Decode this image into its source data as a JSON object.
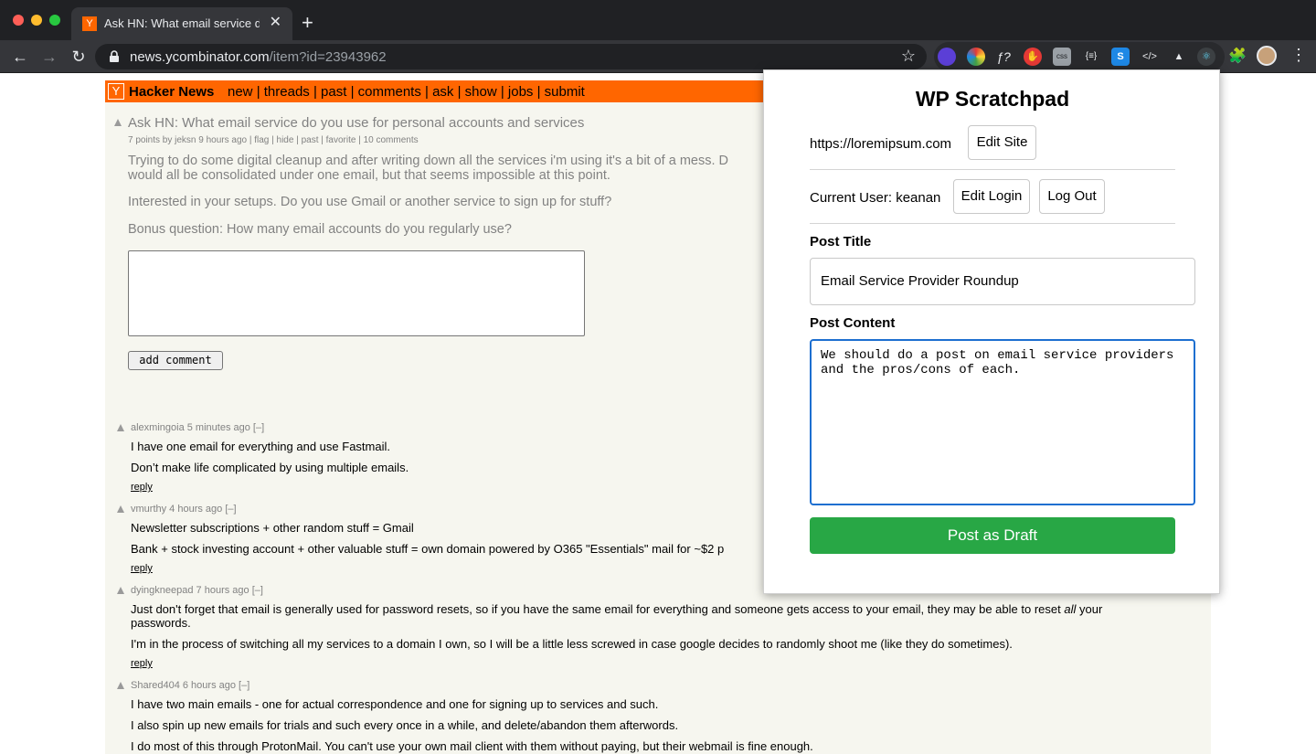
{
  "browser": {
    "tab_title": "Ask HN: What email service do you use",
    "tab_icon": "Y",
    "url_host": "news.ycombinator.com",
    "url_path": "/item?id=23943962"
  },
  "hn": {
    "logo": "Y",
    "brand": "Hacker News",
    "nav": [
      "new",
      "threads",
      "past",
      "comments",
      "ask",
      "show",
      "jobs",
      "submit"
    ],
    "nav_sep": " | ",
    "story": {
      "title": "Ask HN: What email service do you use for personal accounts and services",
      "subtext": "7 points by jeksn 9 hours ago | flag | hide | past | favorite | 10 comments",
      "text_1a": "Trying to do some digital cleanup and after writing down all the services i'm using it's a bit of a mess. D",
      "text_1b": "would all be consolidated under one email, but that seems impossible at this point.",
      "text_2": "Interested in your setups. Do you use Gmail or another service to sign up for stuff?",
      "text_3": "Bonus question: How many email accounts do you regularly use?"
    },
    "add_comment_label": "add comment",
    "comments": [
      {
        "head": "alexmingoia 5 minutes ago [–]",
        "lines": [
          "I have one email for everything and use Fastmail.",
          "Don’t make life complicated by using multiple emails."
        ],
        "reply": "reply"
      },
      {
        "head": "vmurthy 4 hours ago [–]",
        "lines": [
          "Newsletter subscriptions + other random stuff = Gmail",
          "Bank + stock investing account + other valuable stuff = own domain powered by O365 \"Essentials\" mail for ~$2 p"
        ],
        "reply": "reply"
      },
      {
        "head": "dyingkneepad 7 hours ago [–]",
        "lines": [
          "Just don't forget that email is generally used for password resets, so if you have the same email for everything and someone gets access to your email, they may be able to reset",
          "all",
          "your",
          "passwords.",
          "I'm in the process of switching all my services to a domain I own, so I will be a little less screwed in case google decides to randomly shoot me (like they do sometimes)."
        ],
        "reply": "reply"
      },
      {
        "head": "Shared404 6 hours ago [–]",
        "lines": [
          "I have two main emails - one for actual correspondence and one for signing up to services and such.",
          "I also spin up new emails for trials and such every once in a while, and delete/abandon them afterwords.",
          "I do most of this through ProtonMail. You can't use your own mail client with them without paying, but their webmail is fine enough."
        ]
      }
    ]
  },
  "popup": {
    "title": "WP Scratchpad",
    "site_url": "https://loremipsum.com",
    "edit_site_label": "Edit Site",
    "current_user": "Current User: keanan",
    "edit_login_label": "Edit Login",
    "log_out_label": "Log Out",
    "post_title_label": "Post Title",
    "post_title_value": "Email Service Provider Roundup",
    "post_content_label": "Post Content",
    "post_content_value": "We should do a post on email service providers\nand the pros/cons of each.",
    "submit_label": "Post as Draft",
    "submit_color": "#28a745"
  }
}
